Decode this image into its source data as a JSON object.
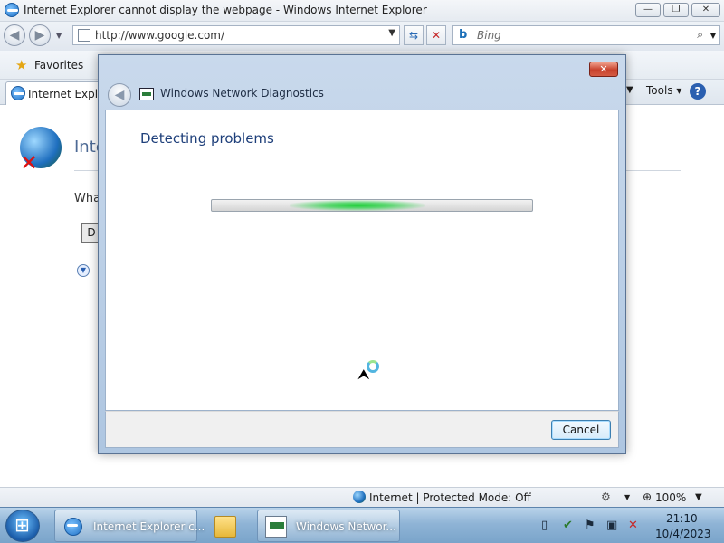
{
  "browser": {
    "window_title": "Internet Explorer cannot display the webpage - Windows Internet Explorer",
    "caption_buttons": {
      "minimize": "—",
      "maximize": "❐",
      "close": "✕"
    },
    "nav": {
      "back_glyph": "◀",
      "forward_glyph": "▶"
    },
    "address": {
      "value": "http://www.google.com/",
      "dropdown_glyph": "▼"
    },
    "refresh_glyph": "⇆",
    "stop_glyph": "✕",
    "search": {
      "engine_glyph": "b",
      "placeholder": "Bing",
      "button_glyph": "⌕"
    },
    "favorites": {
      "star_glyph": "★",
      "label": "Favorites"
    },
    "tab": {
      "label": "Internet Explor"
    },
    "menu": {
      "page_dropdown_glyph": "▼",
      "tools_label": "Tools ▾",
      "help_glyph": "?"
    }
  },
  "error_page": {
    "heading": "Inte",
    "what_text": "What",
    "diagnose_button": "D",
    "more_info_glyph": "▼"
  },
  "status_bar": {
    "zone_text": "Internet | Protected Mode: Off",
    "zoom_label": "100%",
    "zoom_dropdown_glyph": "▼",
    "zoom_icon_glyph": "⊕",
    "settings_glyph": "⚙"
  },
  "dialog": {
    "close_glyph": "✕",
    "back_glyph": "◀",
    "title": "Windows Network Diagnostics",
    "heading": "Detecting problems",
    "progress_indeterminate": true,
    "cancel_label": "Cancel",
    "cursor_glyph": "⮝"
  },
  "taskbar": {
    "items": [
      {
        "label": "Internet Explorer c..."
      },
      {
        "label": ""
      },
      {
        "label": "Windows Networ..."
      }
    ],
    "tray": {
      "icons": [
        "document-icon",
        "shield-icon",
        "flag-icon",
        "network-icon",
        "volume-muted-icon"
      ]
    },
    "clock": {
      "time": "21:10",
      "date": "10/4/2023"
    }
  },
  "icons": {
    "tray_glyphs": [
      "▯",
      "✔",
      "⚑",
      "▣",
      "✕"
    ]
  }
}
